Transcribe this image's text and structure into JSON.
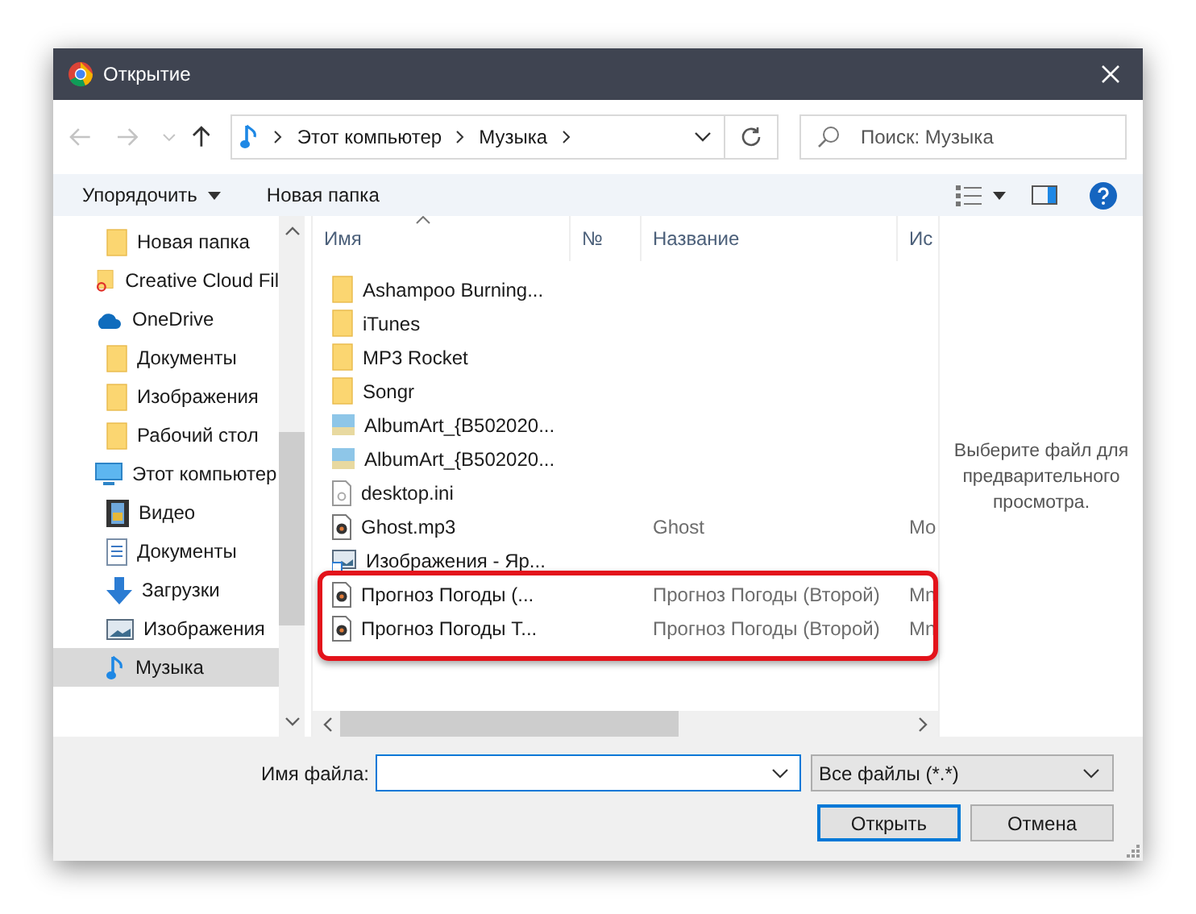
{
  "window": {
    "title": "Открытие"
  },
  "address": {
    "crumbs": [
      "Этот компьютер",
      "Музыка"
    ]
  },
  "search": {
    "placeholder": "Поиск: Музыка"
  },
  "toolbar": {
    "organize": "Упорядочить",
    "new_folder": "Новая папка"
  },
  "sidebar": {
    "items": [
      {
        "children": [
          {
            "kind": "folder",
            "label": "Новая папка",
            "selected": false
          }
        ]
      },
      {
        "kind": "cloudfolder",
        "label": "Creative Cloud Fil",
        "selected": false
      },
      {
        "kind": "onedrive",
        "label": "OneDrive",
        "selected": false,
        "children": [
          {
            "kind": "folder",
            "label": "Документы",
            "selected": false
          },
          {
            "kind": "folder",
            "label": "Изображения",
            "selected": false
          },
          {
            "kind": "folder",
            "label": "Рабочий стол",
            "selected": false
          }
        ]
      },
      {
        "kind": "pc",
        "label": "Этот компьютер",
        "selected": false,
        "children": [
          {
            "kind": "video",
            "label": "Видео",
            "selected": false
          },
          {
            "kind": "docs",
            "label": "Документы",
            "selected": false
          },
          {
            "kind": "downloads",
            "label": "Загрузки",
            "selected": false
          },
          {
            "kind": "pictures",
            "label": "Изображения",
            "selected": false
          },
          {
            "kind": "music",
            "label": "Музыка",
            "selected": true
          }
        ]
      }
    ]
  },
  "table": {
    "columns": [
      "Имя",
      "№",
      "Название",
      "Ис"
    ],
    "rows": [
      {
        "kind": "folder",
        "name": "Ashampoo Burning...",
        "highlighted": false
      },
      {
        "kind": "folder",
        "name": "iTunes",
        "highlighted": false
      },
      {
        "kind": "folder",
        "name": "MP3 Rocket",
        "highlighted": false
      },
      {
        "kind": "folder",
        "name": "Songr",
        "highlighted": false
      },
      {
        "kind": "image",
        "name": "AlbumArt_{B502020...",
        "highlighted": false
      },
      {
        "kind": "image",
        "name": "AlbumArt_{B502020...",
        "highlighted": false
      },
      {
        "kind": "ini",
        "name": "desktop.ini",
        "highlighted": false
      },
      {
        "kind": "audio",
        "name": "Ghost.mp3",
        "title": "Ghost",
        "column_4": "Mo",
        "highlighted": false
      },
      {
        "kind": "shortcut",
        "name": "Изображения - Яр...",
        "highlighted": false
      },
      {
        "kind": "audio",
        "name": "Прогноз Погоды (...",
        "title": "Прогноз Погоды (Второй)",
        "column_4": "Mn",
        "highlighted": true
      },
      {
        "kind": "audio",
        "name": "Прогноз Погоды Т...",
        "title": "Прогноз Погоды (Второй)",
        "column_4": "Mn",
        "highlighted": true
      }
    ]
  },
  "preview": {
    "message": "Выберите файл для предварительного просмотра."
  },
  "footer": {
    "filename_label": "Имя файла:",
    "filter": "Все файлы (*.*)",
    "buttons": [
      {
        "label": "Открыть",
        "default": true
      },
      {
        "label": "Отмена",
        "default": false
      }
    ]
  }
}
